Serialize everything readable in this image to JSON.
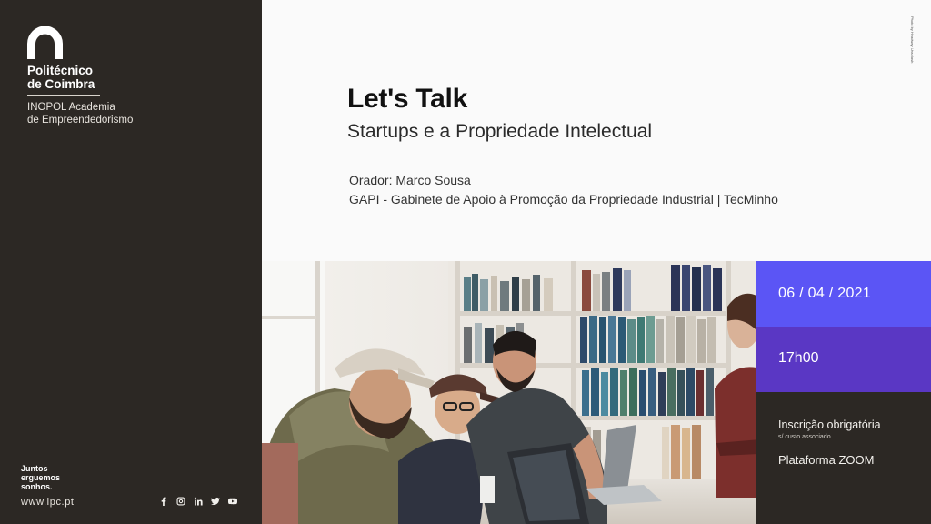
{
  "sidebar": {
    "brand_line1": "Politécnico",
    "brand_line2": "de Coimbra",
    "academy_line1": "INOPOL Academia",
    "academy_line2": "de Empreendedorismo",
    "motto_line1": "Juntos",
    "motto_line2": "erguemos",
    "motto_line3": "sonhos.",
    "website": "www.ipc.pt",
    "socials": [
      "facebook-icon",
      "instagram-icon",
      "linkedin-icon",
      "twitter-icon",
      "youtube-icon"
    ]
  },
  "event": {
    "title": "Let's Talk",
    "subtitle": "Startups e a Propriedade Intelectual",
    "speaker": "Orador: Marco Sousa",
    "organization": "GAPI - Gabinete de Apoio à Promoção da Propriedade Industrial | TecMinho",
    "photo_credit": "Photo by Headway Unsplash"
  },
  "info": {
    "date": "06 / 04 / 2021",
    "time": "17h00",
    "registration": "Inscrição obrigatória",
    "registration_note": "s/ custo associado",
    "platform": "Plataforma ZOOM"
  },
  "colors": {
    "sidebar_bg": "#2c2824",
    "date_bg": "#5b55f5",
    "time_bg": "#5a37c4",
    "page_bg": "#fafafa"
  }
}
